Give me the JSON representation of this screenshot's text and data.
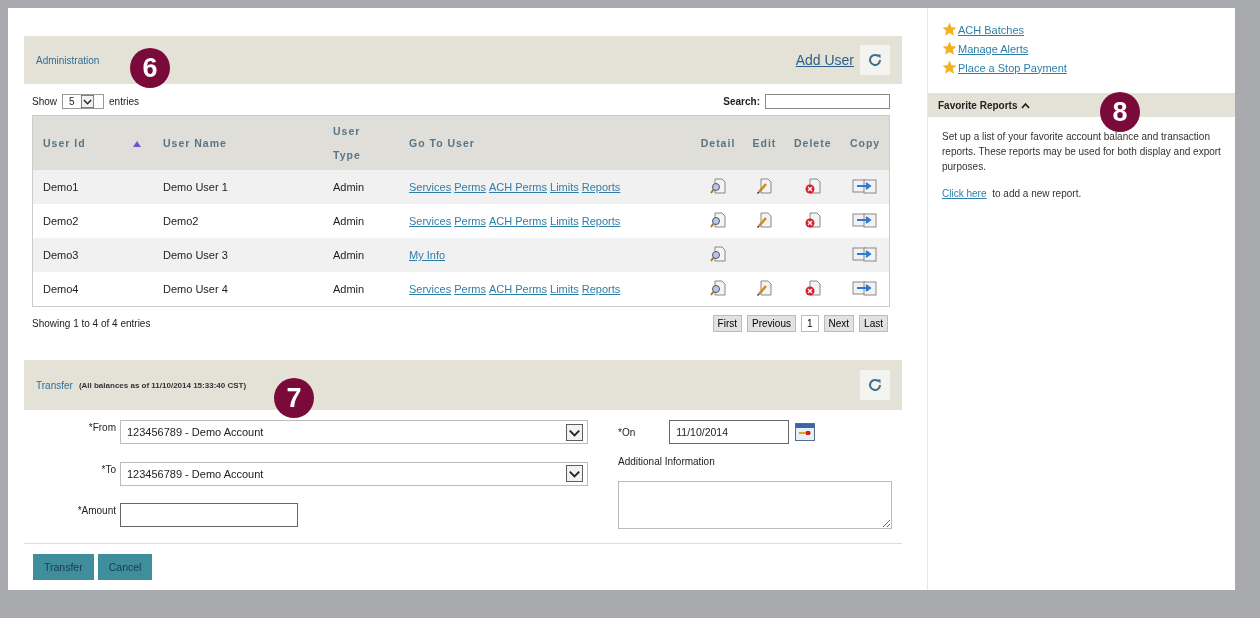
{
  "admin": {
    "title": "Administration",
    "callout": "6",
    "add_user": "Add User",
    "show_label": "Show",
    "page_size": "5",
    "entries_label": "entries",
    "search_label": "Search:",
    "columns": [
      "User Id",
      "User Name",
      "User Type",
      "Go To User",
      "Detail",
      "Edit",
      "Delete",
      "Copy"
    ],
    "rows": [
      {
        "id": "Demo1",
        "name": "Demo User 1",
        "type": "Admin",
        "links": [
          "Services",
          "Perms",
          "ACH Perms",
          "Limits",
          "Reports"
        ],
        "detail": true,
        "edit": true,
        "delete": true,
        "copy": true
      },
      {
        "id": "Demo2",
        "name": "Demo2",
        "type": "Admin",
        "links": [
          "Services",
          "Perms",
          "ACH Perms",
          "Limits",
          "Reports"
        ],
        "detail": true,
        "edit": true,
        "delete": true,
        "copy": true
      },
      {
        "id": "Demo3",
        "name": "Demo User 3",
        "type": "Admin",
        "links": [
          "My Info"
        ],
        "detail": true,
        "edit": false,
        "delete": false,
        "copy": true
      },
      {
        "id": "Demo4",
        "name": "Demo User 4",
        "type": "Admin",
        "links": [
          "Services",
          "Perms",
          "ACH Perms",
          "Limits",
          "Reports"
        ],
        "detail": true,
        "edit": true,
        "delete": true,
        "copy": true
      }
    ],
    "summary": "Showing 1 to 4 of 4 entries",
    "pager": [
      {
        "label": "First",
        "kind": "button"
      },
      {
        "label": "Previous",
        "kind": "button"
      },
      {
        "label": "1",
        "kind": "page"
      },
      {
        "label": "Next",
        "kind": "button"
      },
      {
        "label": "Last",
        "kind": "button"
      }
    ]
  },
  "transfer": {
    "title": "Transfer",
    "subtitle": "(All balances as of 11/10/2014 15:33:40 CST)",
    "callout": "7",
    "from_label": "*From",
    "from_value": "123456789 - Demo Account",
    "to_label": "*To",
    "to_value": "123456789 - Demo Account",
    "amount_label": "*Amount",
    "on_label": "*On",
    "on_value": "11/10/2014",
    "info_label": "Additional Information",
    "buttons": [
      "Transfer",
      "Cancel"
    ]
  },
  "sidebar": {
    "links": [
      "ACH Batches",
      "Manage Alerts",
      "Place a Stop Payment"
    ],
    "reports_title": "Favorite Reports",
    "callout": "8",
    "reports_text": "Set up a list of your favorite account balance and transaction reports. These reports may be used for both display and export purposes.",
    "click_link": "Click here",
    "click_rest": "to add a new report."
  }
}
